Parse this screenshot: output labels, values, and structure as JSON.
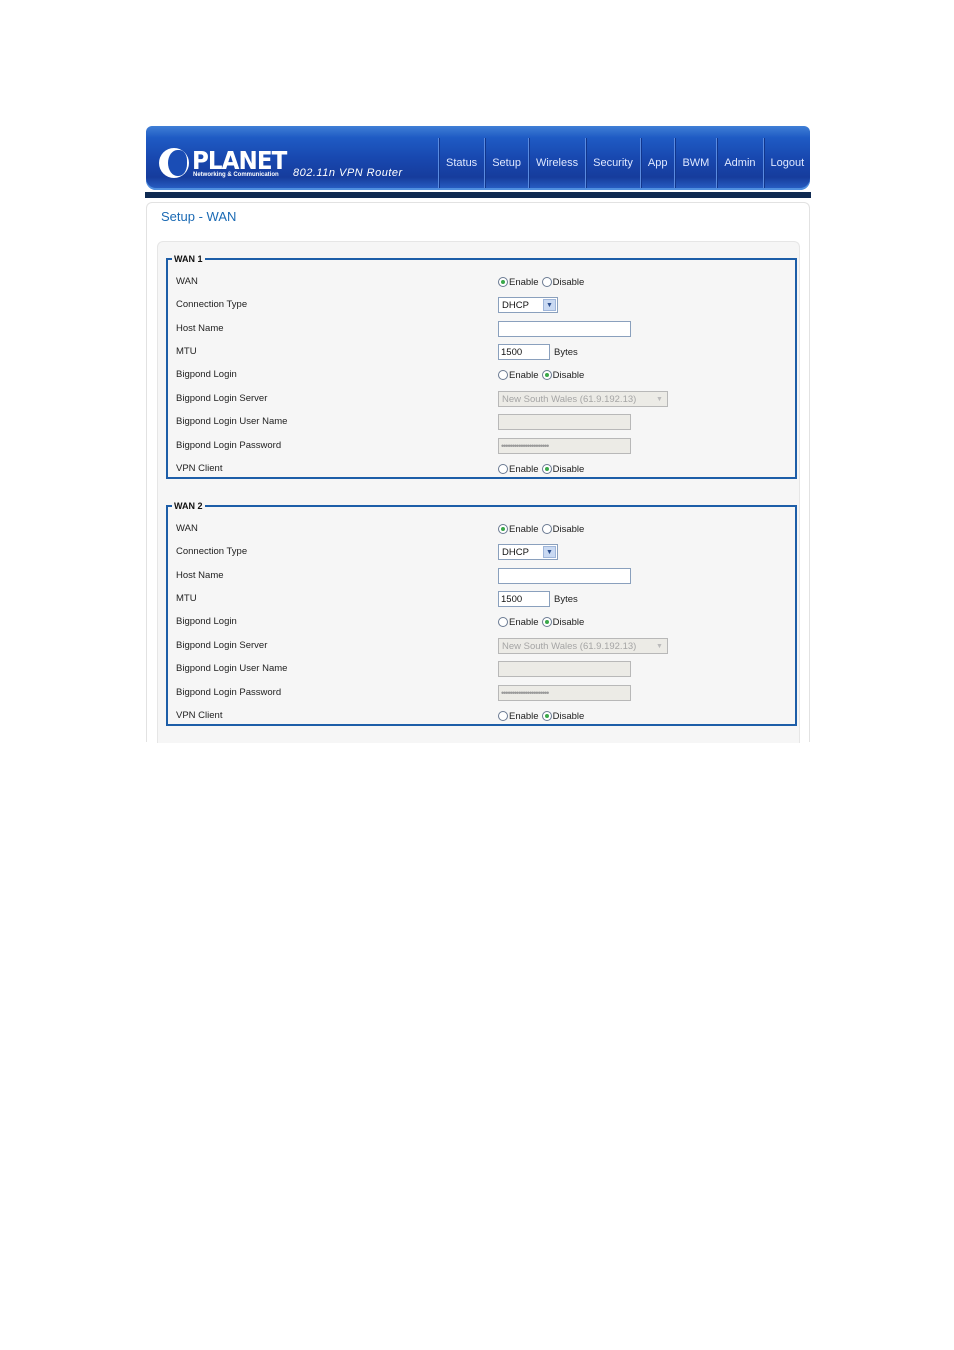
{
  "header": {
    "brand": "PLANET",
    "tagline": "Networking & Communication",
    "model": "802.11n VPN Router",
    "nav": [
      "Status",
      "Setup",
      "Wireless",
      "Security",
      "App",
      "BWM",
      "Admin",
      "Logout"
    ]
  },
  "page": {
    "title": "Setup - WAN"
  },
  "options": {
    "enable": "Enable",
    "disable": "Disable",
    "bytes_unit": "Bytes"
  },
  "wan1": {
    "legend": "WAN 1",
    "labels": {
      "wan": "WAN",
      "connection_type": "Connection Type",
      "host_name": "Host Name",
      "mtu": "MTU",
      "bigpond_login": "Bigpond Login",
      "bigpond_server": "Bigpond Login Server",
      "bigpond_user": "Bigpond Login User Name",
      "bigpond_password": "Bigpond Login Password",
      "vpn_client": "VPN Client"
    },
    "values": {
      "wan": "Enable",
      "connection_type": "DHCP",
      "host_name": "",
      "mtu": "1500",
      "bigpond_login": "Disable",
      "bigpond_server": "New South Wales (61.9.192.13)",
      "bigpond_user": "",
      "bigpond_password": "••••••••••••••••••••••",
      "vpn_client": "Disable"
    }
  },
  "wan2": {
    "legend": "WAN 2",
    "labels": {
      "wan": "WAN",
      "connection_type": "Connection Type",
      "host_name": "Host Name",
      "mtu": "MTU",
      "bigpond_login": "Bigpond Login",
      "bigpond_server": "Bigpond Login Server",
      "bigpond_user": "Bigpond Login User Name",
      "bigpond_password": "Bigpond Login Password",
      "vpn_client": "VPN Client"
    },
    "values": {
      "wan": "Enable",
      "connection_type": "DHCP",
      "host_name": "",
      "mtu": "1500",
      "bigpond_login": "Disable",
      "bigpond_server": "New South Wales (61.9.192.13)",
      "bigpond_user": "",
      "bigpond_password": "••••••••••••••••••••••",
      "vpn_client": "Disable"
    }
  }
}
